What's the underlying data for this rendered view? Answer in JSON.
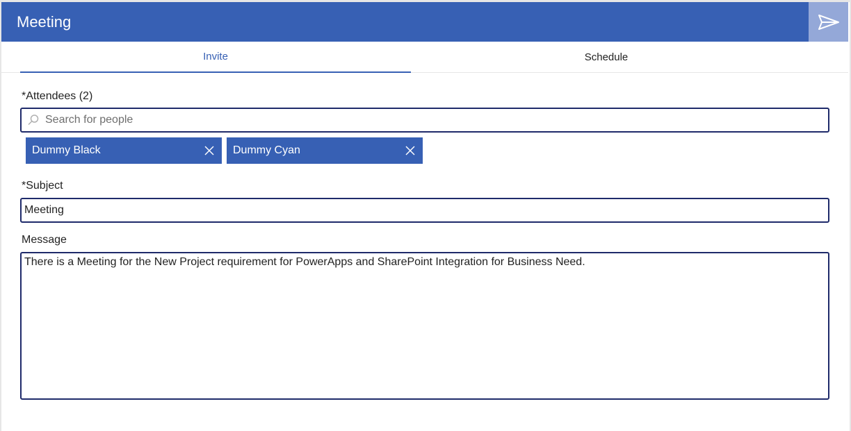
{
  "header": {
    "title": "Meeting",
    "send_icon": "send-icon"
  },
  "tabs": [
    {
      "label": "Invite",
      "active": true
    },
    {
      "label": "Schedule",
      "active": false
    }
  ],
  "attendees": {
    "label": "*Attendees (2)",
    "search_placeholder": "Search for people",
    "search_value": "",
    "chips": [
      {
        "name": "Dummy Black"
      },
      {
        "name": "Dummy Cyan"
      }
    ]
  },
  "subject": {
    "label": "*Subject",
    "value": "Meeting"
  },
  "message": {
    "label": "Message",
    "value": "There is a Meeting for the New Project requirement for PowerApps and SharePoint Integration for Business Need."
  },
  "colors": {
    "brand": "#3760b4",
    "send_bg": "#94a8d8",
    "border": "#1e2a6a"
  }
}
